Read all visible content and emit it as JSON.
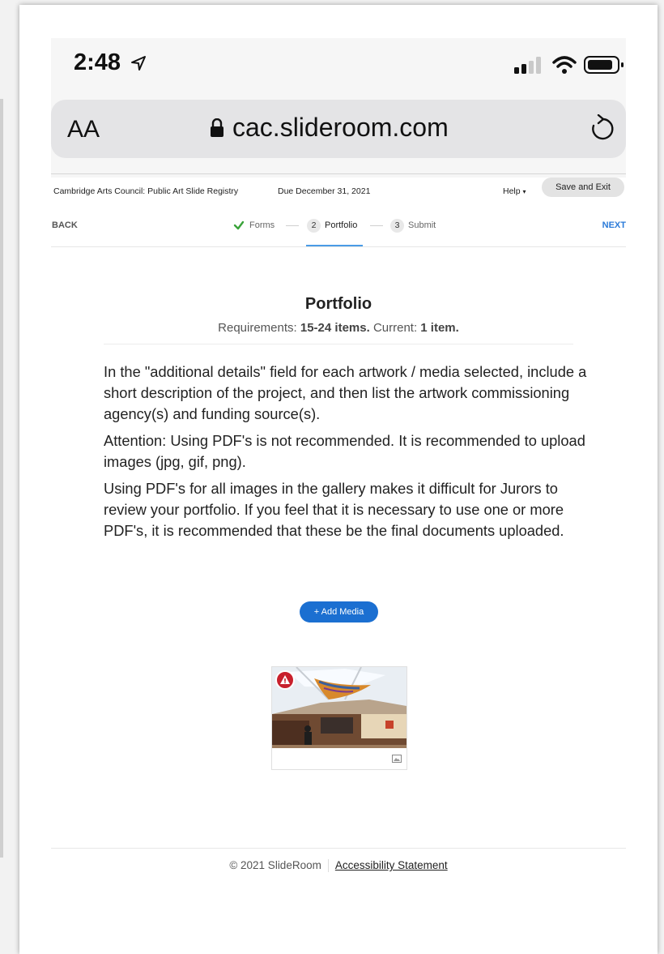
{
  "status_bar": {
    "time": "2:48"
  },
  "browser": {
    "text_size_label": "AA",
    "url": "cac.slideroom.com"
  },
  "header": {
    "registry_title": "Cambridge Arts Council: Public Art Slide Registry",
    "due": "Due December 31, 2021",
    "help_label": "Help",
    "save_exit_label": "Save and Exit"
  },
  "steps": {
    "back_label": "BACK",
    "next_label": "NEXT",
    "items": [
      {
        "badge": "",
        "label": "Forms",
        "state": "complete"
      },
      {
        "badge": "2",
        "label": "Portfolio",
        "state": "active"
      },
      {
        "badge": "3",
        "label": "Submit",
        "state": "upcoming"
      }
    ]
  },
  "portfolio": {
    "title": "Portfolio",
    "requirements_prefix": "Requirements:",
    "requirements_range": "15-24 items.",
    "current_prefix": "Current:",
    "current_count": "1 item.",
    "paragraphs": [
      "In the \"additional details\" field for each artwork / media selected, include a short description of the project, and then list the artwork commissioning agency(s) and funding source(s).",
      "Attention: Using PDF's is not recommended. It is recommended to upload images (jpg, gif, png).",
      "Using PDF's for all images in the gallery makes it difficult for Jurors to review your portfolio. If you feel that it is necessary to use one or more PDF's, it is recommended that these be the final documents uploaded."
    ],
    "add_media_label": "+ Add Media"
  },
  "footer": {
    "copyright": "© 2021 SlideRoom",
    "accessibility_link": "Accessibility Statement"
  },
  "colors": {
    "primary": "#1b6fd1",
    "next_link": "#2a7ad8",
    "complete_check": "#3aa33a",
    "warning": "#c8202c",
    "active_underline": "#4a9be6"
  }
}
